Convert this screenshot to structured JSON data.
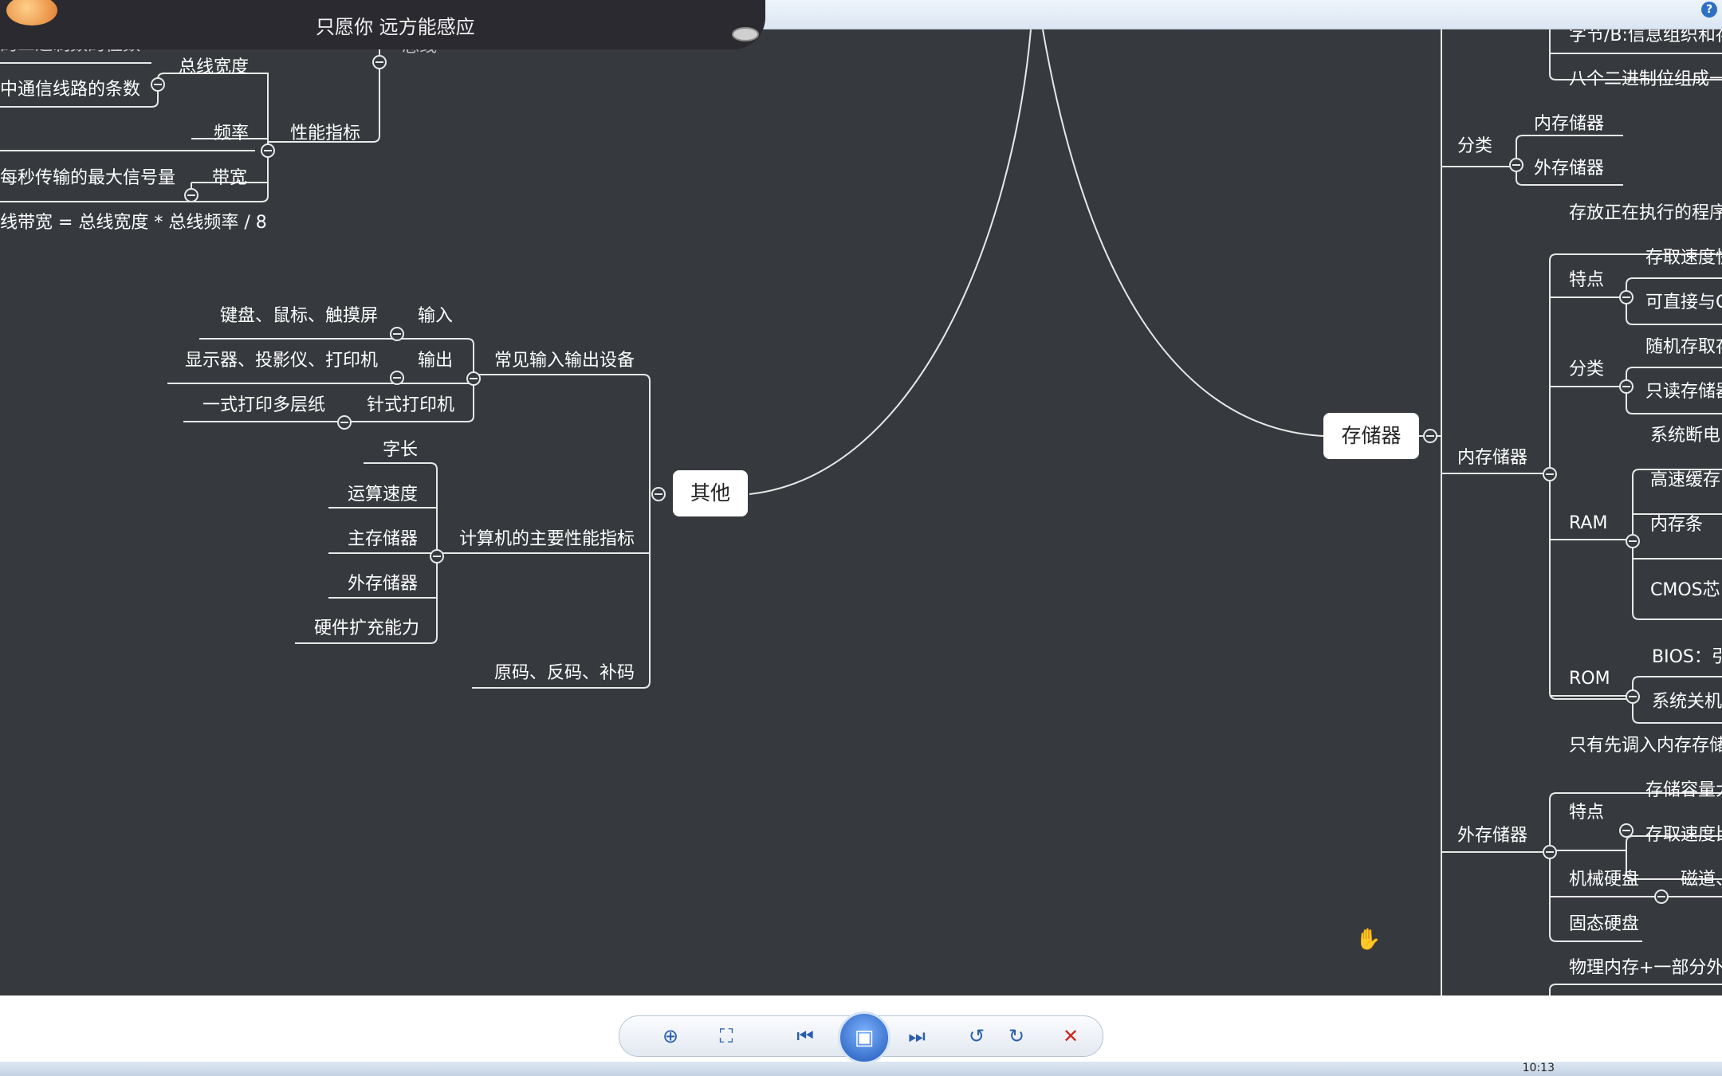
{
  "music": {
    "lyric": "只愿你 远方能感应"
  },
  "mindmap": {
    "left_top": {
      "partial_top": "的二进制数的位数",
      "bus_width": "总线宽度",
      "bus_lines": "中通信线路的条数",
      "frequency": "频率",
      "performance": "性能指标",
      "bandwidth": "带宽",
      "max_signal": "每秒传输的最大信号量",
      "bandwidth_formula": "线带宽 = 总线宽度 * 总线频率 / 8",
      "partial_root": "总线"
    },
    "other": {
      "node": "其他",
      "io_devices": "常见输入输出设备",
      "input": "输入",
      "input_items": "键盘、鼠标、触摸屏",
      "output": "输出",
      "output_items": "显示器、投影仪、打印机",
      "dot_printer": "针式打印机",
      "dot_printer_desc": "一式打印多层纸",
      "perf_indicators": "计算机的主要性能指标",
      "perf_items": [
        "字长",
        "运算速度",
        "主存储器",
        "外存储器",
        "硬件扩充能力"
      ],
      "codes": "原码、反码、补码"
    },
    "storage": {
      "node": "存储器",
      "byte_unit": "字节/B:信息组织和存",
      "eight_bits": "八个二进制位组成一",
      "classify": "分类",
      "classify_items": [
        "内存储器",
        "外存储器"
      ],
      "internal": "内存储器",
      "internal_desc": "存放正在执行的程序",
      "feature": "特点",
      "feature_items": [
        "存取速度快",
        "可直接与C"
      ],
      "int_classify": "分类",
      "int_classify_items": [
        "随机存取存",
        "只读存储器"
      ],
      "ram": "RAM",
      "ram_items": [
        "系统断电",
        "高速缓存",
        "内存条",
        "CMOS芯"
      ],
      "rom": "ROM",
      "rom_items": [
        "BIOS：引",
        "系统关机"
      ],
      "external": "外存储器",
      "ext_desc": "只有先调入内存存储",
      "ext_feature": "特点",
      "ext_feature_items": [
        "存储容量大",
        "存取速度比"
      ],
      "hdd": "机械硬盘",
      "hdd_desc": "磁道、",
      "ssd": "固态硬盘",
      "virtual": "物理内存+一部分外"
    }
  },
  "toolbar": {
    "zoom": "⊕",
    "fit": "⛶",
    "prev": "⏮",
    "slideshow": "▣",
    "next": "⏭",
    "rotate_ccw": "↺",
    "rotate_cw": "↻",
    "delete": "✕"
  },
  "help": "?",
  "clock": "10:13",
  "colors": {
    "canvas": "#363a3e",
    "line": "#e8e8e8",
    "delete": "#d0241b"
  }
}
